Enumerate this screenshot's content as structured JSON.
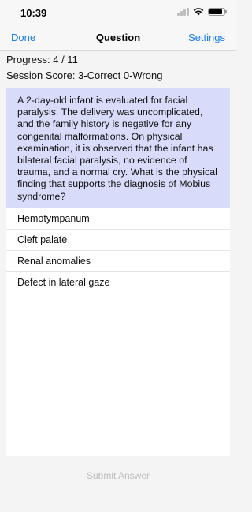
{
  "status_bar": {
    "time": "10:39"
  },
  "nav": {
    "left": "Done",
    "title": "Question",
    "right": "Settings"
  },
  "progress": "Progress: 4 / 11",
  "score": "Session Score: 3-Correct 0-Wrong",
  "question": "A 2-day-old infant is evaluated for facial paralysis. The delivery was uncomplicated, and the family history is negative for any congenital malformations. On physical examination, it is observed that the infant has bilateral facial paralysis, no evidence of trauma, and a normal cry. What is the physical finding that supports the diagnosis of Mobius syndrome?",
  "options": [
    "Hemotympanum",
    "Cleft palate",
    "Renal anomalies",
    "Defect in lateral gaze"
  ],
  "submit_label": "Submit Answer",
  "icons": [
    "signal-icon",
    "wifi-icon",
    "battery-icon"
  ],
  "colors": {
    "accent": "#1a7cf5",
    "question_bg": "#d8dcfa",
    "disabled": "#bdbdbd"
  }
}
